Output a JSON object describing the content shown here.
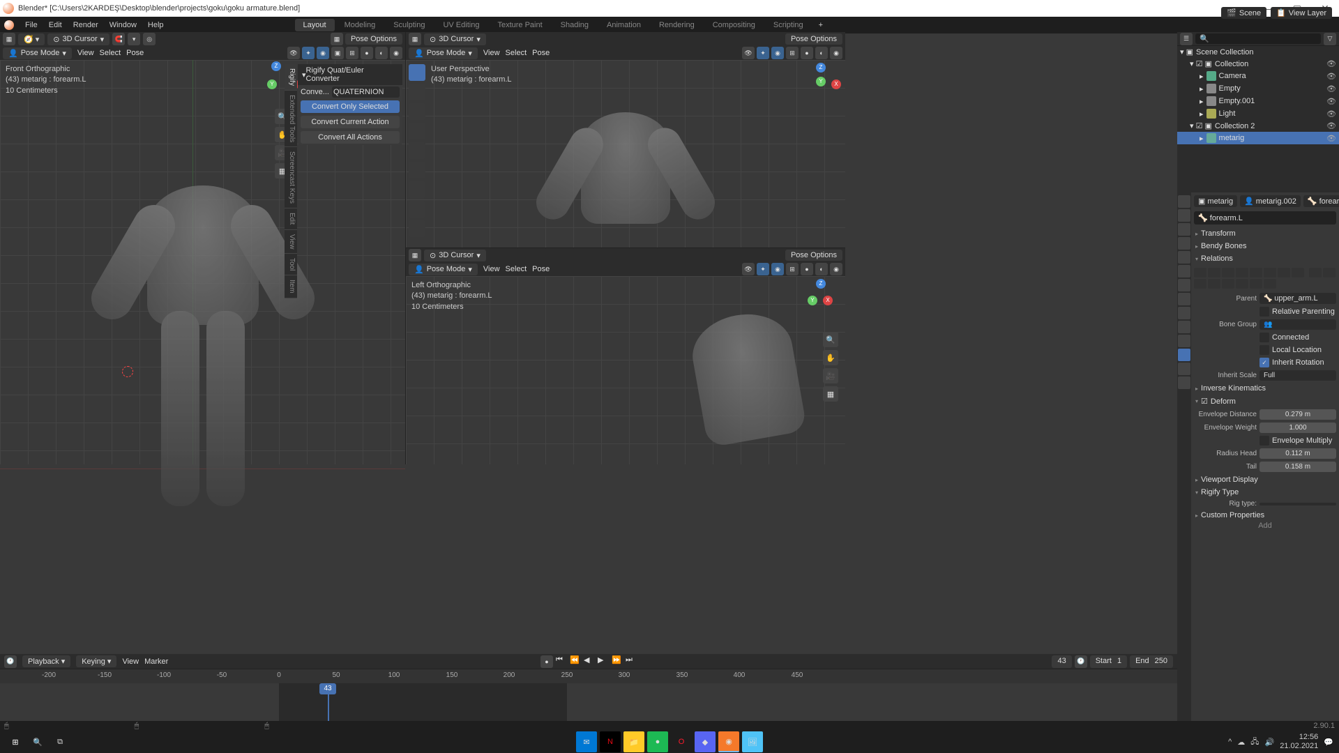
{
  "title": "Blender* [C:\\Users\\2KARDEŞ\\Desktop\\blender\\projects\\goku\\goku armature.blend]",
  "topmenu": [
    "File",
    "Edit",
    "Render",
    "Window",
    "Help"
  ],
  "workspaces": [
    "Layout",
    "Modeling",
    "Sculpting",
    "UV Editing",
    "Texture Paint",
    "Shading",
    "Animation",
    "Rendering",
    "Compositing",
    "Scripting"
  ],
  "active_workspace": "Layout",
  "scene": "Scene",
  "viewlayer": "View Layer",
  "vpheader": {
    "mode": "Pose Mode",
    "view": "View",
    "select": "Select",
    "pose": "Pose",
    "pivot": "3D Cursor",
    "poseopt": "Pose Options"
  },
  "vp1": {
    "info1": "Front Orthographic",
    "info2": "(43) metarig : forearm.L",
    "info3": "10 Centimeters"
  },
  "vp2": {
    "info1": "User Perspective",
    "info2": "(43) metarig : forearm.L"
  },
  "vp3": {
    "info1": "Left Orthographic",
    "info2": "(43) metarig : forearm.L",
    "info3": "10 Centimeters"
  },
  "rigify": {
    "title": "Rigify Quat/Euler Converter",
    "convert": "Conve...",
    "rotmode": "QUATERNION",
    "btn1": "Convert Only Selected",
    "btn2": "Convert Current Action",
    "btn3": "Convert All Actions"
  },
  "sidetabs": [
    "Rigify",
    "Extended Tools",
    "Screencast Keys",
    "Edit",
    "View",
    "Tool",
    "Item"
  ],
  "timeline": {
    "playback": "Playback",
    "keying": "Keying",
    "view": "View",
    "marker": "Marker",
    "frame": "43",
    "start_l": "Start",
    "start_v": "1",
    "end_l": "End",
    "end_v": "250",
    "ticks": [
      "-200",
      "-150",
      "-100",
      "-50",
      "0",
      "50",
      "100",
      "150",
      "200",
      "250",
      "300",
      "350",
      "400",
      "450"
    ]
  },
  "outliner": {
    "root": "Scene Collection",
    "items": [
      {
        "name": "Collection",
        "type": "col"
      },
      {
        "name": "Camera",
        "type": "cam",
        "indent": 2
      },
      {
        "name": "Empty",
        "type": "emp",
        "indent": 2
      },
      {
        "name": "Empty.001",
        "type": "emp",
        "indent": 2
      },
      {
        "name": "Light",
        "type": "lit",
        "indent": 2
      },
      {
        "name": "Collection 2",
        "type": "col"
      },
      {
        "name": "metarig",
        "type": "arm",
        "indent": 2,
        "selected": true
      }
    ]
  },
  "props": {
    "path": [
      "metarig",
      "metarig.002",
      "forear"
    ],
    "bone": "forearm.L",
    "panels": {
      "transform": "Transform",
      "bendy": "Bendy Bones",
      "relations": "Relations",
      "ik": "Inverse Kinematics",
      "deform": "Deform",
      "vpdisp": "Viewport Display",
      "rigtype": "Rigify Type",
      "custom": "Custom Properties"
    },
    "parent_l": "Parent",
    "parent_v": "upper_arm.L",
    "relparent": "Relative Parenting",
    "bonegroup_l": "Bone Group",
    "connected": "Connected",
    "locallocation": "Local Location",
    "inheritrot": "Inherit Rotation",
    "inheritscale_l": "Inherit Scale",
    "inheritscale_v": "Full",
    "envdist_l": "Envelope Distance",
    "envdist_v": "0.279 m",
    "envweight_l": "Envelope Weight",
    "envweight_v": "1.000",
    "envmult": "Envelope Multiply",
    "radhead_l": "Radius Head",
    "radhead_v": "0.112 m",
    "tail_l": "Tail",
    "tail_v": "0.158 m",
    "rigtype_l": "Rig type:",
    "add": "Add"
  },
  "version": "2.90.1",
  "taskbar": {
    "time": "12:56",
    "date": "21.02.2021"
  }
}
